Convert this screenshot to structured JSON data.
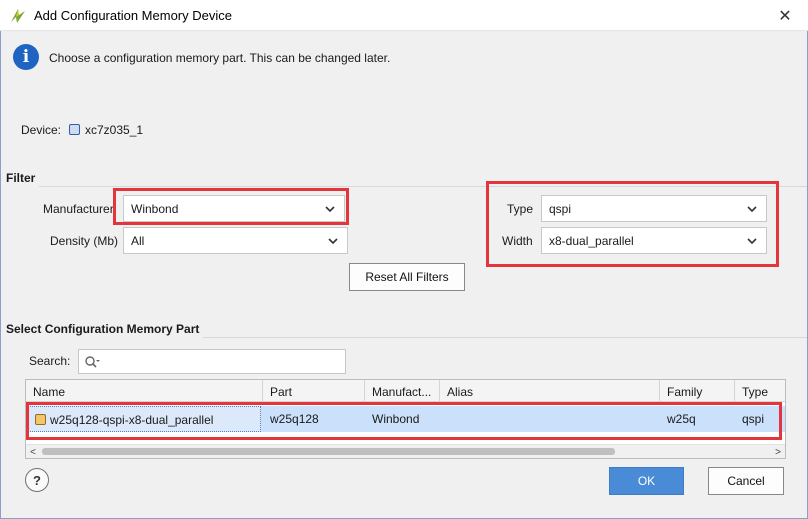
{
  "window": {
    "title": "Add Configuration Memory Device",
    "close_glyph": "✕"
  },
  "info": {
    "icon_letter": "i",
    "message": "Choose a configuration memory part. This can be changed later."
  },
  "device": {
    "label": "Device:",
    "value": "xc7z035_1"
  },
  "filter": {
    "section_title": "Filter",
    "manufacturer": {
      "label": "Manufacturer",
      "value": "Winbond"
    },
    "density": {
      "label": "Density (Mb)",
      "value": "All"
    },
    "type": {
      "label": "Type",
      "value": "qspi"
    },
    "width": {
      "label": "Width",
      "value": "x8-dual_parallel"
    },
    "reset_button": "Reset All Filters"
  },
  "select_section": {
    "title": "Select Configuration Memory Part",
    "search_label": "Search:",
    "search_value": ""
  },
  "table": {
    "columns": [
      "Name",
      "Part",
      "Manufact...",
      "Alias",
      "Family",
      "Type"
    ],
    "rows": [
      {
        "name": "w25q128-qspi-x8-dual_parallel",
        "part": "w25q128",
        "manufacturer": "Winbond",
        "alias": "",
        "family": "w25q",
        "type": "qspi"
      }
    ],
    "scroll_left": "<",
    "scroll_right": ">"
  },
  "footer": {
    "help": "?",
    "ok": "OK",
    "cancel": "Cancel"
  },
  "colors": {
    "highlight_red": "#e4343c",
    "ok_blue": "#4a8bd8",
    "selected_row": "#cbe0fa",
    "info_blue": "#1f64c2"
  },
  "icons": {
    "app": "vivado-logo-icon",
    "info": "info-icon",
    "device": "chip-icon",
    "search": "search-icon",
    "dropdown": "chevron-down-icon",
    "part": "memory-part-icon"
  }
}
